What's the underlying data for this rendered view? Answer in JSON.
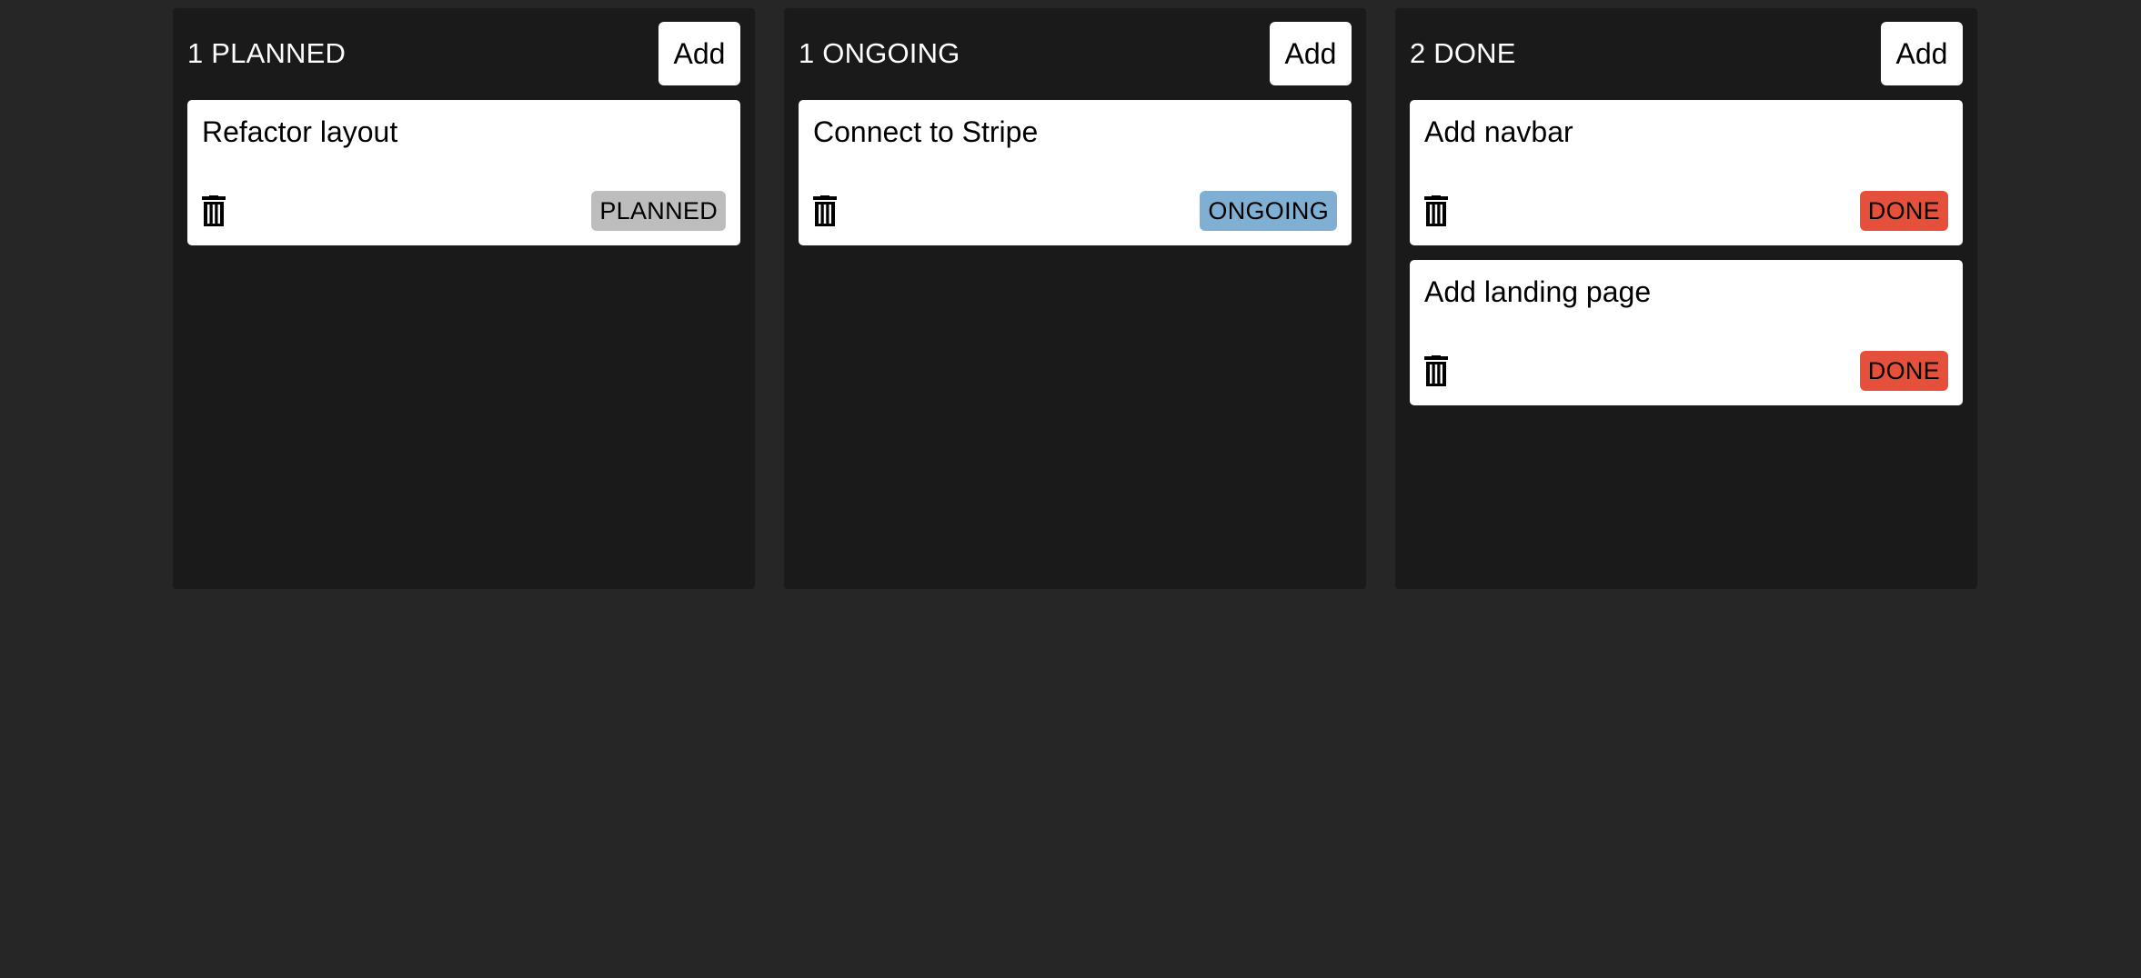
{
  "columns": [
    {
      "title": "1 PLANNED",
      "add_label": "Add",
      "cards": [
        {
          "title": "Refactor layout",
          "status": "PLANNED",
          "status_color": "#bdbdbd"
        }
      ]
    },
    {
      "title": "1 ONGOING",
      "add_label": "Add",
      "cards": [
        {
          "title": "Connect to Stripe",
          "status": "ONGOING",
          "status_color": "#7fb0d3"
        }
      ]
    },
    {
      "title": "2 DONE",
      "add_label": "Add",
      "cards": [
        {
          "title": "Add navbar",
          "status": "DONE",
          "status_color": "#e5503c"
        },
        {
          "title": "Add landing page",
          "status": "DONE",
          "status_color": "#e5503c"
        }
      ]
    }
  ],
  "icons": {
    "delete": "trash-icon"
  },
  "colors": {
    "page_background": "#262626",
    "column_background": "#1a1a1a",
    "card_background": "#ffffff"
  }
}
